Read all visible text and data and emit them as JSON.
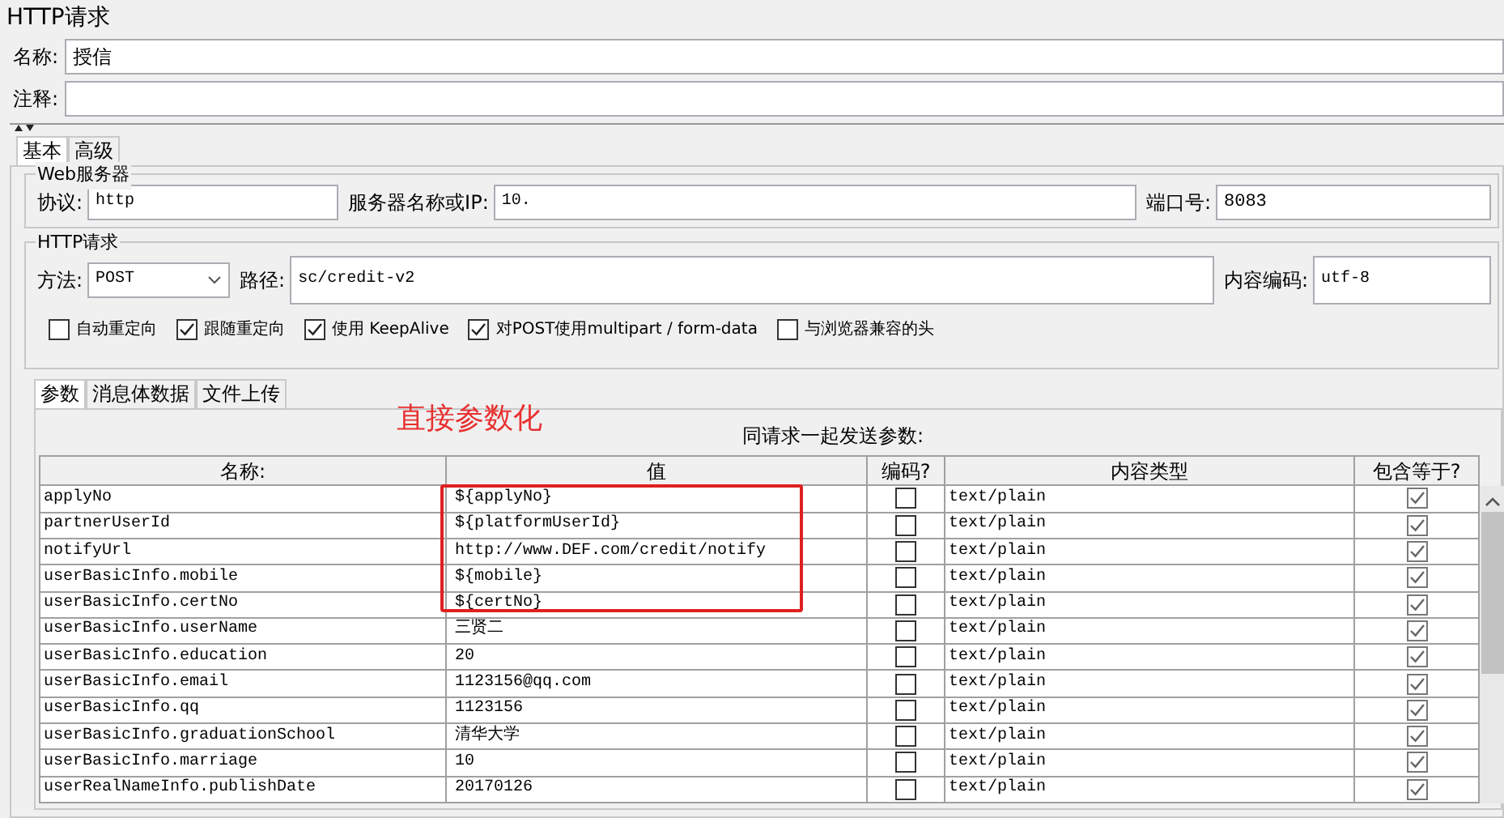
{
  "window": {
    "title": "HTTP请求"
  },
  "name_field": {
    "label": "名称:",
    "value": "授信"
  },
  "comment_field": {
    "label": "注释:"
  },
  "tabs": [
    {
      "label": "基本",
      "selected": true
    },
    {
      "label": "高级",
      "selected": false
    }
  ],
  "web_server": {
    "title": "Web服务器",
    "protocol": {
      "label": "协议:",
      "value": "http"
    },
    "server": {
      "label": "服务器名称或IP:",
      "value": "10."
    },
    "port": {
      "label": "端口号:",
      "value": "8083"
    }
  },
  "http_request": {
    "title": "HTTP请求",
    "method": {
      "label": "方法:",
      "value": "POST"
    },
    "path": {
      "label": "路径:",
      "value": "sc/credit-v2"
    },
    "encoding": {
      "label": "内容编码:",
      "value": "utf-8"
    },
    "options": [
      {
        "label": "自动重定向",
        "checked": false
      },
      {
        "label": "跟随重定向",
        "checked": true
      },
      {
        "label": "使用 KeepAlive",
        "checked": true
      },
      {
        "label": "对POST使用multipart / form-data",
        "checked": true
      },
      {
        "label": "与浏览器兼容的头",
        "checked": false
      }
    ]
  },
  "sub_tabs": [
    {
      "label": "参数",
      "selected": true
    },
    {
      "label": "消息体数据",
      "selected": false
    },
    {
      "label": "文件上传",
      "selected": false
    }
  ],
  "annotation": "直接参数化",
  "params": {
    "title": "同请求一起发送参数:",
    "columns": [
      "名称:",
      "值",
      "编码?",
      "内容类型",
      "包含等于?"
    ],
    "rows": [
      {
        "name": "applyNo",
        "value": "${applyNo}",
        "encode": false,
        "content_type": "text/plain",
        "include_equals": true
      },
      {
        "name": "partnerUserId",
        "value": "${platformUserId}",
        "encode": false,
        "content_type": "text/plain",
        "include_equals": true
      },
      {
        "name": "notifyUrl",
        "value": "http://www.DEF.com/credit/notify",
        "encode": false,
        "content_type": "text/plain",
        "include_equals": true
      },
      {
        "name": "userBasicInfo.mobile",
        "value": "${mobile}",
        "encode": false,
        "content_type": "text/plain",
        "include_equals": true
      },
      {
        "name": "userBasicInfo.certNo",
        "value": "${certNo}",
        "encode": false,
        "content_type": "text/plain",
        "include_equals": true
      },
      {
        "name": "userBasicInfo.userName",
        "value": "三贤二",
        "encode": false,
        "content_type": "text/plain",
        "include_equals": true
      },
      {
        "name": "userBasicInfo.education",
        "value": "20",
        "encode": false,
        "content_type": "text/plain",
        "include_equals": true
      },
      {
        "name": "userBasicInfo.email",
        "value": "1123156@qq.com",
        "encode": false,
        "content_type": "text/plain",
        "include_equals": true
      },
      {
        "name": "userBasicInfo.qq",
        "value": "1123156",
        "encode": false,
        "content_type": "text/plain",
        "include_equals": true
      },
      {
        "name": "userBasicInfo.graduationSchool",
        "value": "清华大学",
        "encode": false,
        "content_type": "text/plain",
        "include_equals": true
      },
      {
        "name": "userBasicInfo.marriage",
        "value": "10",
        "encode": false,
        "content_type": "text/plain",
        "include_equals": true
      },
      {
        "name": "userRealNameInfo.publishDate",
        "value": "20170126",
        "encode": false,
        "content_type": "text/plain",
        "include_equals": true
      }
    ]
  }
}
